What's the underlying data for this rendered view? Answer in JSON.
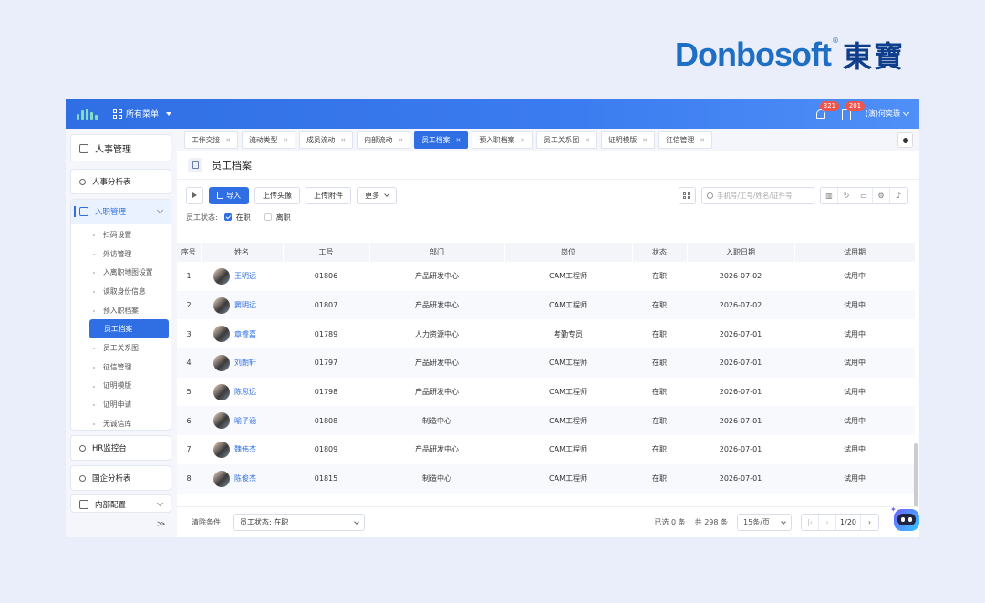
{
  "brand": {
    "text": "Donbosoft",
    "reg": "®",
    "cn": "東寶"
  },
  "topbar": {
    "menu_label": "所有菜单",
    "bell_badge": "321",
    "doc_badge": "201",
    "user": "(演)何奕璇"
  },
  "sidebar": {
    "title": "人事管理",
    "groups": [
      "人事分析表",
      "入职管理"
    ],
    "sub_items": [
      "扫码设置",
      "外访管理",
      "入离职地图设置",
      "读取身份信息",
      "预入职档案",
      "员工档案",
      "员工关系图",
      "征信管理",
      "证明模版",
      "证明申请",
      "无诚信库"
    ],
    "bottom_groups": [
      "HR监控台",
      "国企分析表",
      "内部配置"
    ],
    "collapse_icon": "≫"
  },
  "tabs": [
    "工作交接",
    "流动类型",
    "成员流动",
    "内部流动",
    "员工档案",
    "预入职档案",
    "员工关系图",
    "证明模版",
    "征信管理"
  ],
  "page": {
    "title": "员工档案",
    "import_label": "导入",
    "upload_avatar_label": "上传头像",
    "upload_attach_label": "上传附件",
    "more_label": "更多",
    "search_placeholder": "手机号/工号/姓名/证件号",
    "filter_label": "员工状态:",
    "filter_on": "在职",
    "filter_off": "离职"
  },
  "table": {
    "headers": [
      "序号",
      "姓名",
      "工号",
      "部门",
      "岗位",
      "状态",
      "入职日期",
      "试用期"
    ],
    "rows": [
      [
        "1",
        "王明远",
        "01806",
        "产品研发中心",
        "CAM工程师",
        "在职",
        "2026-07-02",
        "试用中"
      ],
      [
        "2",
        "窦明远",
        "01807",
        "产品研发中心",
        "CAM工程师",
        "在职",
        "2026-07-02",
        "试用中"
      ],
      [
        "3",
        "章睿嘉",
        "01789",
        "人力资源中心",
        "考勤专员",
        "在职",
        "2026-07-01",
        "试用中"
      ],
      [
        "4",
        "刘朗轩",
        "01797",
        "产品研发中心",
        "CAM工程师",
        "在职",
        "2026-07-01",
        "试用中"
      ],
      [
        "5",
        "陈思远",
        "01798",
        "产品研发中心",
        "CAM工程师",
        "在职",
        "2026-07-01",
        "试用中"
      ],
      [
        "6",
        "喻子涵",
        "01808",
        "制造中心",
        "CAM工程师",
        "在职",
        "2026-07-01",
        "试用中"
      ],
      [
        "7",
        "魏伟杰",
        "01809",
        "产品研发中心",
        "CAM工程师",
        "在职",
        "2026-07-01",
        "试用中"
      ],
      [
        "8",
        "陈俊杰",
        "01815",
        "制造中心",
        "CAM工程师",
        "在职",
        "2026-07-01",
        "试用中"
      ]
    ]
  },
  "footer": {
    "clear_label": "清除条件",
    "filter_select": "员工状态: 在职",
    "selected_text": "已选 0 条",
    "total_text": "共 298 条",
    "page_size": "15条/页",
    "page_indicator": "1/20"
  }
}
